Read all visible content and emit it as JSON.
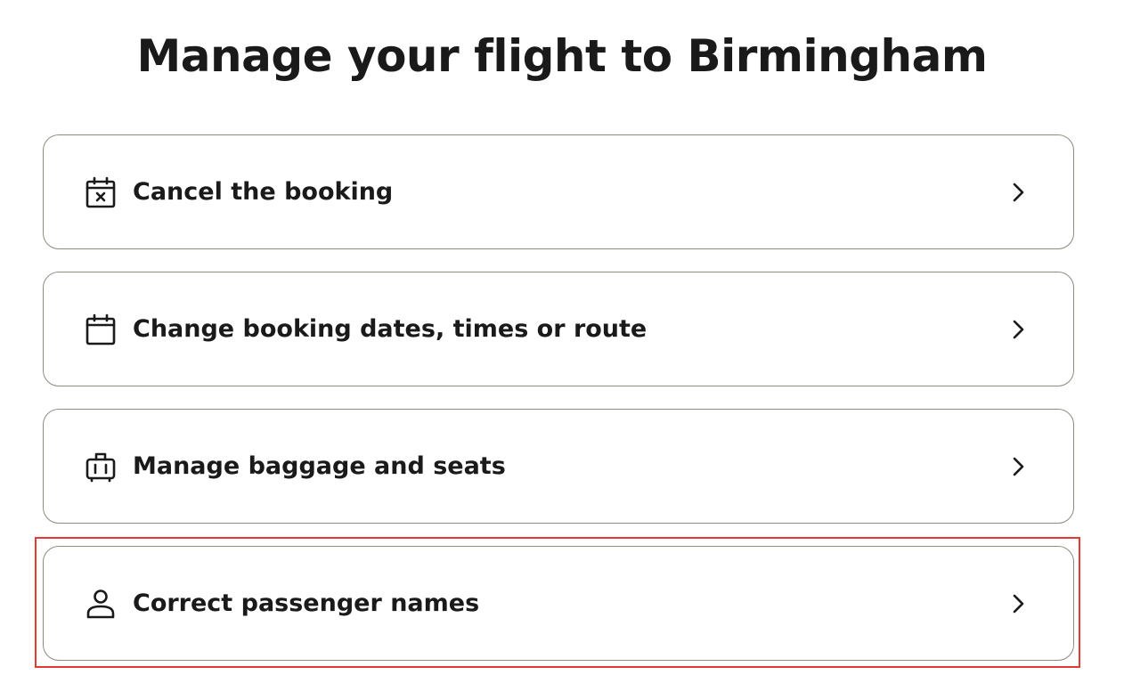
{
  "page": {
    "title": "Manage your flight to Birmingham"
  },
  "options": [
    {
      "label": "Cancel the booking",
      "icon": "calendar-x-icon"
    },
    {
      "label": "Change booking dates, times or route",
      "icon": "calendar-icon"
    },
    {
      "label": "Manage baggage and seats",
      "icon": "luggage-icon"
    },
    {
      "label": "Correct passenger names",
      "icon": "person-icon"
    }
  ],
  "colors": {
    "text": "#1a1a1a",
    "card_border": "#8e8c80",
    "highlight": "#e53935"
  }
}
